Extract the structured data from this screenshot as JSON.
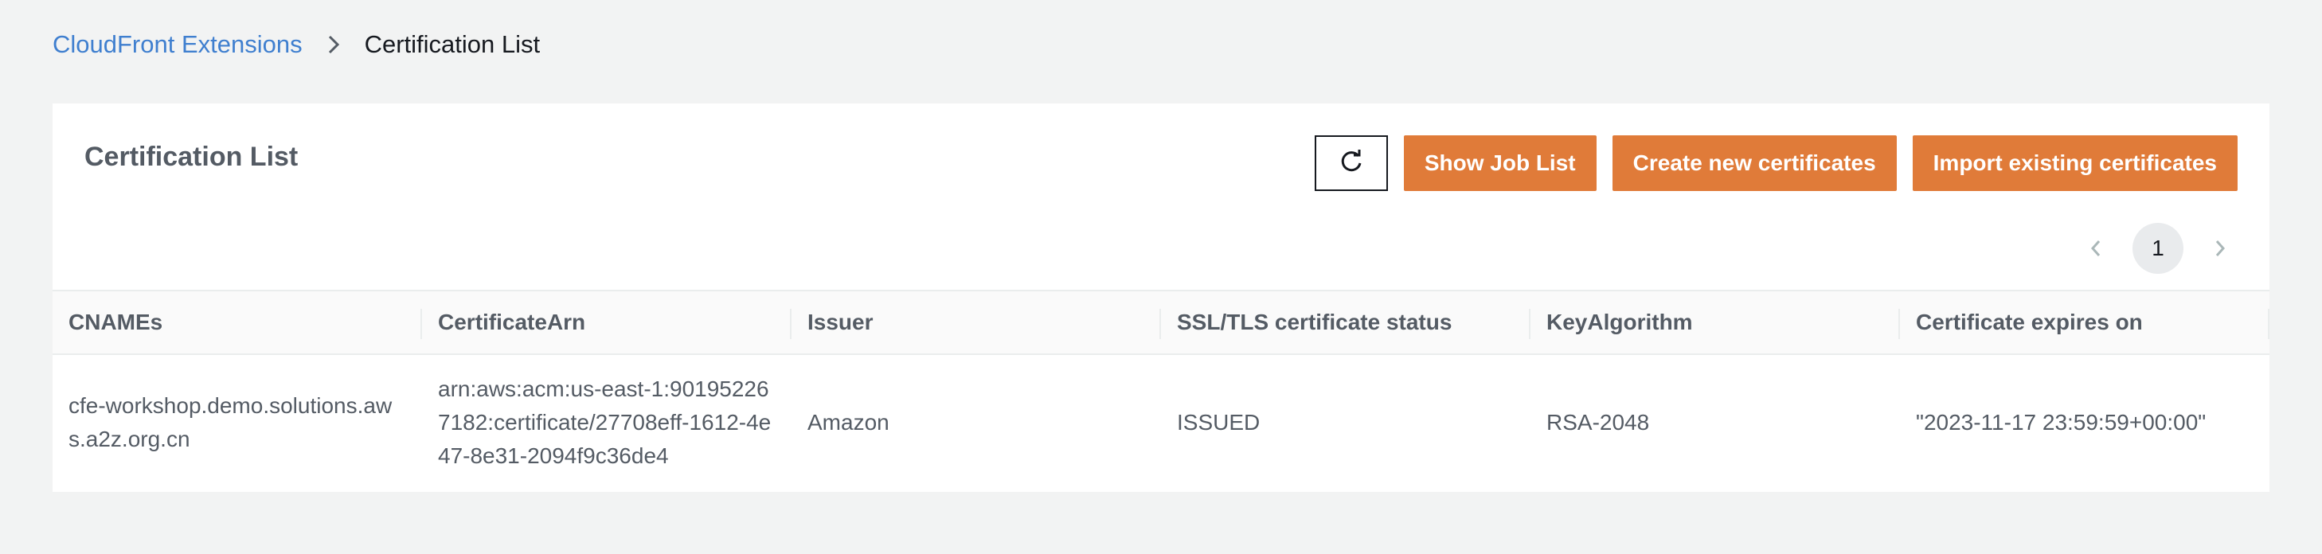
{
  "breadcrumb": {
    "parent": "CloudFront Extensions",
    "current": "Certification List",
    "separator_icon": "chevron-right-icon"
  },
  "card": {
    "title": "Certification List",
    "actions": {
      "refresh_icon": "refresh-icon",
      "show_job_list": "Show Job List",
      "create_new": "Create new certificates",
      "import_existing": "Import existing certificates"
    },
    "accent_color": "#e07b39"
  },
  "pagination": {
    "current_page": "1",
    "prev_icon": "chevron-left-icon",
    "next_icon": "chevron-right-icon"
  },
  "table": {
    "columns": [
      "CNAMEs",
      "CertificateArn",
      "Issuer",
      "SSL/TLS certificate status",
      "KeyAlgorithm",
      "Certificate expires on"
    ],
    "rows": [
      {
        "cnames": "cfe-workshop.demo.solutions.aws.a2z.org.cn",
        "arn": "arn:aws:acm:us-east-1:901952267182:certificate/27708eff-1612-4e47-8e31-2094f9c36de4",
        "issuer": "Amazon",
        "status": "ISSUED",
        "key_algorithm": "RSA-2048",
        "expires": "\"2023-11-17 23:59:59+00:00\""
      }
    ]
  }
}
